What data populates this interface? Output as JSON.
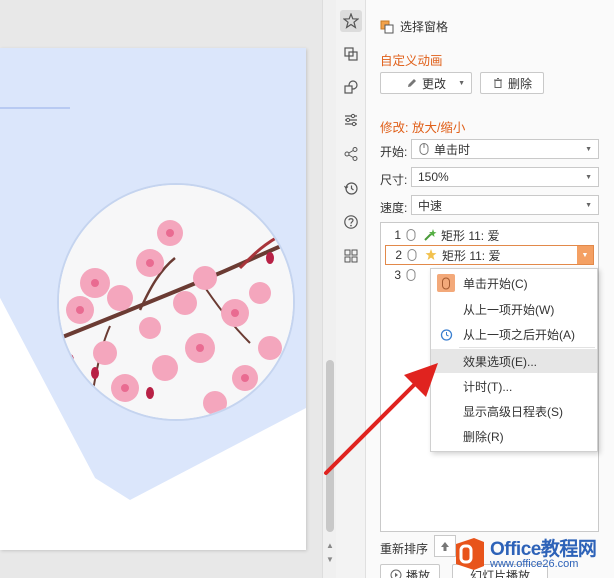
{
  "pane": {
    "title": "选择窗格",
    "section_custom": "自定义动画",
    "change_label": "更改",
    "delete_label": "删除",
    "modify_title": "修改: 放大/缩小",
    "start_label": "开始:",
    "start_value": "单击时",
    "size_label": "尺寸:",
    "size_value": "150%",
    "speed_label": "速度:",
    "speed_value": "中速"
  },
  "animations": [
    {
      "num": "1",
      "label": "矩形 11: 爱"
    },
    {
      "num": "2",
      "label": "矩形 11: 爱"
    },
    {
      "num": "3",
      "label": ""
    }
  ],
  "context_menu": [
    {
      "label": "单击开始(C)",
      "icon": "mouse-icon"
    },
    {
      "label": "从上一项开始(W)",
      "icon": ""
    },
    {
      "label": "从上一项之后开始(A)",
      "icon": "clock-icon"
    },
    {
      "label": "效果选项(E)...",
      "icon": ""
    },
    {
      "label": "计时(T)...",
      "icon": ""
    },
    {
      "label": "显示高级日程表(S)",
      "icon": ""
    },
    {
      "label": "删除(R)",
      "icon": ""
    }
  ],
  "bottom": {
    "reorder_label": "重新排序",
    "play_label": "播放",
    "slideshow_label": "幻灯片播放"
  },
  "watermark": {
    "brand": "Office教程网",
    "url": "www.office26.com"
  },
  "colors": {
    "accent_orange": "#e0601a",
    "selection_orange": "#f4a063",
    "slide_blue": "#dbe6fb",
    "arrow_red": "#e0231f",
    "watermark_blue": "#2d62b8"
  }
}
